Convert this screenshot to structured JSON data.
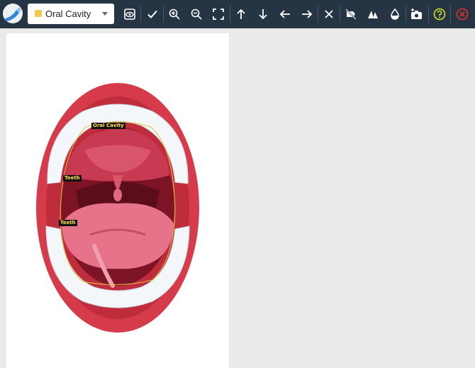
{
  "toolbar": {
    "label_select": {
      "value": "Oral Cavity",
      "swatch_color": "#f2c94c"
    },
    "icons": [
      "eye-icon",
      "check-icon",
      "zoom-in-icon",
      "zoom-out-icon",
      "fullscreen-icon",
      "arrow-up-icon",
      "arrow-down-icon",
      "arrow-left-icon",
      "arrow-right-icon",
      "close-icon",
      "hide-icon",
      "shapes-icon",
      "opacity-icon",
      "add-photo-icon",
      "help-icon",
      "cancel-icon"
    ]
  },
  "canvas": {
    "annotations": [
      {
        "label": "Oral Cavity"
      },
      {
        "label": "Teeth"
      },
      {
        "label": "Teeth"
      }
    ]
  },
  "colors": {
    "toolbar_bg": "#263544",
    "background": "#e9eaea",
    "annotation_tag_text": "#ffe14d",
    "help_icon": "#d7e32a",
    "cancel_icon": "#e03131"
  }
}
